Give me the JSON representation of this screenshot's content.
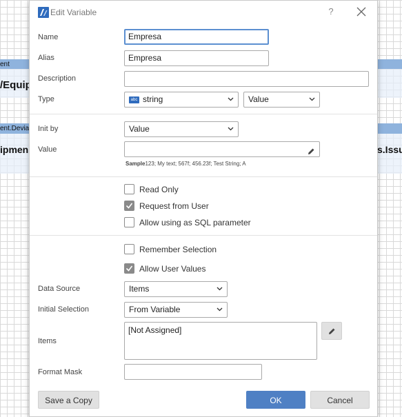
{
  "background": {
    "fragment_1": "ent",
    "fragment_2": "/Equipr",
    "fragment_3": "ent.Devia",
    "fragment_4": "ipmen",
    "fragment_5": "s.Issu"
  },
  "dialog": {
    "title": "Edit Variable",
    "help_label": "?",
    "fields": {
      "name_label": "Name",
      "name_value": "Empresa",
      "alias_label": "Alias",
      "alias_value": "Empresa",
      "description_label": "Description",
      "description_value": "",
      "type_label": "Type",
      "type_badge": "abc",
      "type_value": "string",
      "type_mode_value": "Value",
      "init_by_label": "Init by",
      "init_by_value": "Value",
      "value_label": "Value",
      "value_value": "",
      "sample_bold": "Sample",
      "sample_text": "123; My text; 567f; 456.23f; Test String; A"
    },
    "options": {
      "read_only": {
        "label": "Read Only",
        "checked": false
      },
      "request_from_user": {
        "label": "Request from User",
        "checked": true
      },
      "allow_sql_param": {
        "label": "Allow using as SQL parameter",
        "checked": false
      },
      "remember_selection": {
        "label": "Remember Selection",
        "checked": false
      },
      "allow_user_values": {
        "label": "Allow User Values",
        "checked": true
      }
    },
    "user_values": {
      "data_source_label": "Data Source",
      "data_source_value": "Items",
      "initial_selection_label": "Initial Selection",
      "initial_selection_value": "From Variable",
      "items_label": "Items",
      "items_value": "[Not Assigned]",
      "format_mask_label": "Format Mask",
      "format_mask_value": ""
    },
    "buttons": {
      "save_copy": "Save a Copy",
      "ok": "OK",
      "cancel": "Cancel"
    },
    "colors": {
      "accent": "#4f80c4",
      "checkbox_checked": "#8a8a8a",
      "background_band": "#8fb3dd"
    }
  }
}
